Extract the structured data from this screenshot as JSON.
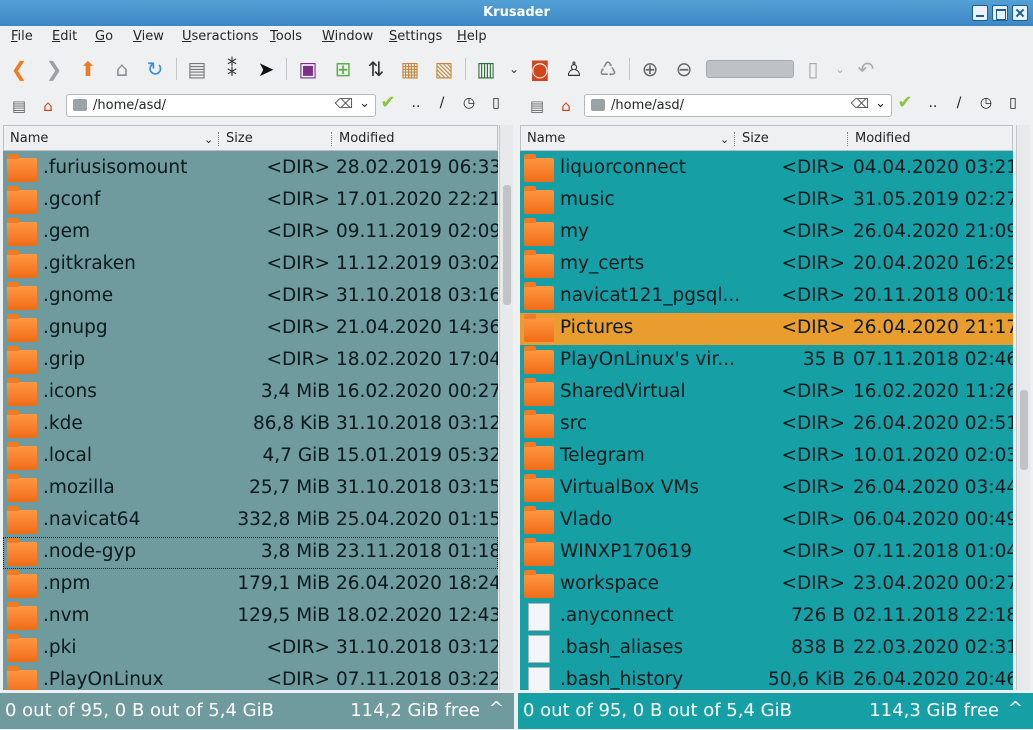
{
  "window": {
    "title": "Krusader"
  },
  "menu": [
    "File",
    "Edit",
    "Go",
    "View",
    "Useractions",
    "Tools",
    "Window",
    "Settings",
    "Help"
  ],
  "toolbar": {
    "icons": [
      "back-icon",
      "forward-icon",
      "up-arrow-icon",
      "home-icon",
      "refresh-icon",
      "view-file-icon",
      "compare-icon",
      "select-cursor-icon",
      "terminal-icon",
      "new-file-icon",
      "swap-panels-icon",
      "package-icon",
      "unpack-icon",
      "mount-icon",
      "screenshot-icon",
      "user-icon",
      "trash-icon",
      "zoom-in-icon",
      "zoom-out-icon",
      "split-icon",
      "undo-icon"
    ]
  },
  "left": {
    "path": "/home/asd/",
    "columns": {
      "name": "Name",
      "size": "Size",
      "modified": "Modified"
    },
    "rows": [
      {
        "name": ".furiusisomount",
        "size": "<DIR>",
        "modified": "28.02.2019 06:33",
        "type": "folder"
      },
      {
        "name": ".gconf",
        "size": "<DIR>",
        "modified": "17.01.2020 22:21",
        "type": "folder"
      },
      {
        "name": ".gem",
        "size": "<DIR>",
        "modified": "09.11.2019 02:09",
        "type": "folder"
      },
      {
        "name": ".gitkraken",
        "size": "<DIR>",
        "modified": "11.12.2019 03:02",
        "type": "folder"
      },
      {
        "name": ".gnome",
        "size": "<DIR>",
        "modified": "31.10.2018 03:16",
        "type": "folder"
      },
      {
        "name": ".gnupg",
        "size": "<DIR>",
        "modified": "21.04.2020 14:36",
        "type": "folder"
      },
      {
        "name": ".grip",
        "size": "<DIR>",
        "modified": "18.02.2020 17:04",
        "type": "folder"
      },
      {
        "name": ".icons",
        "size": "3,4 MiB",
        "modified": "16.02.2020 00:27",
        "type": "folder"
      },
      {
        "name": ".kde",
        "size": "86,8 KiB",
        "modified": "31.10.2018 03:12",
        "type": "folder"
      },
      {
        "name": ".local",
        "size": "4,7 GiB",
        "modified": "15.01.2019 05:32",
        "type": "folder"
      },
      {
        "name": ".mozilla",
        "size": "25,7 MiB",
        "modified": "31.10.2018 03:15",
        "type": "folder"
      },
      {
        "name": ".navicat64",
        "size": "332,8 MiB",
        "modified": "25.04.2020 01:15",
        "type": "folder"
      },
      {
        "name": ".node-gyp",
        "size": "3,8 MiB",
        "modified": "23.11.2018 01:18",
        "type": "folder",
        "focus": true
      },
      {
        "name": ".npm",
        "size": "179,1 MiB",
        "modified": "26.04.2020 18:24",
        "type": "folder"
      },
      {
        "name": ".nvm",
        "size": "129,5 MiB",
        "modified": "18.02.2020 12:43",
        "type": "folder"
      },
      {
        "name": ".pki",
        "size": "<DIR>",
        "modified": "31.10.2018 03:12",
        "type": "folder"
      },
      {
        "name": ".PlayOnLinux",
        "size": "<DIR>",
        "modified": "07.11.2018 03:22",
        "type": "folder"
      }
    ],
    "status": {
      "selection": "0 out of 95, 0 B out of 5,4 GiB",
      "free": "114,2 GiB free"
    }
  },
  "right": {
    "path": "/home/asd/",
    "columns": {
      "name": "Name",
      "size": "Size",
      "modified": "Modified"
    },
    "rows": [
      {
        "name": "liquorconnect",
        "size": "<DIR>",
        "modified": "04.04.2020 03:21",
        "type": "folder"
      },
      {
        "name": "music",
        "size": "<DIR>",
        "modified": "31.05.2019 02:27",
        "type": "folder"
      },
      {
        "name": "my",
        "size": "<DIR>",
        "modified": "26.04.2020 21:09",
        "type": "folder"
      },
      {
        "name": "my_certs",
        "size": "<DIR>",
        "modified": "20.04.2020 16:29",
        "type": "folder"
      },
      {
        "name": "navicat121_pgsql...",
        "size": "<DIR>",
        "modified": "20.11.2018 00:18",
        "type": "folder"
      },
      {
        "name": "Pictures",
        "size": "<DIR>",
        "modified": "26.04.2020 21:17",
        "type": "folder",
        "selected": true
      },
      {
        "name": "PlayOnLinux's vir...",
        "size": "35 B",
        "modified": "07.11.2018 02:46",
        "type": "folder"
      },
      {
        "name": "SharedVirtual",
        "size": "<DIR>",
        "modified": "16.02.2020 11:26",
        "type": "folder"
      },
      {
        "name": "src",
        "size": "<DIR>",
        "modified": "26.04.2020 02:51",
        "type": "folder"
      },
      {
        "name": "Telegram",
        "size": "<DIR>",
        "modified": "10.01.2020 02:03",
        "type": "folder"
      },
      {
        "name": "VirtualBox VMs",
        "size": "<DIR>",
        "modified": "26.04.2020 03:44",
        "type": "folder"
      },
      {
        "name": "Vlado",
        "size": "<DIR>",
        "modified": "06.04.2020 00:49",
        "type": "folder"
      },
      {
        "name": "WINXP170619",
        "size": "<DIR>",
        "modified": "07.11.2018 01:04",
        "type": "folder"
      },
      {
        "name": "workspace",
        "size": "<DIR>",
        "modified": "23.04.2020 00:27",
        "type": "folder"
      },
      {
        "name": ".anyconnect",
        "size": "726 B",
        "modified": "02.11.2018 22:18",
        "type": "file"
      },
      {
        "name": ".bash_aliases",
        "size": "838 B",
        "modified": "22.03.2020 02:31",
        "type": "file"
      },
      {
        "name": ".bash_history",
        "size": "50,6 KiB",
        "modified": "26.04.2020 20:46",
        "type": "file"
      }
    ],
    "status": {
      "selection": "0 out of 95, 0 B out of 5,4 GiB",
      "free": "114,3 GiB free"
    }
  }
}
